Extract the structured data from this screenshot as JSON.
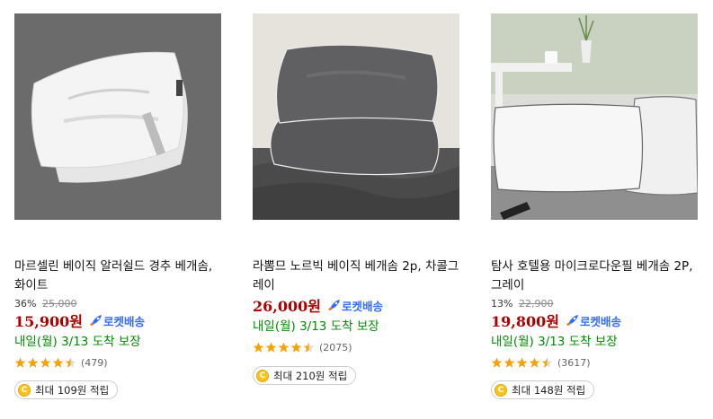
{
  "products": [
    {
      "name": "마르셀린 베이직 알러쉴드 경추 베개솜, 화이트",
      "discount_rate": "36%",
      "original_price": "25,000",
      "price": "15,900원",
      "delivery_badge": "로켓배송",
      "arrival": "내일(월) 3/13 도착 보장",
      "rating": 4.5,
      "review_count": "(479)",
      "reward": "최대 109원 적립",
      "image": "white-neck-pillow-gray-background"
    },
    {
      "name": "라뽐므 노르빅 베이직 베개솜 2p, 차콜그레이",
      "discount_rate": "",
      "original_price": "",
      "price": "26,000원",
      "delivery_badge": "로켓배송",
      "arrival": "내일(월) 3/13 도착 보장",
      "rating": 4.5,
      "review_count": "(2075)",
      "reward": "최대 210원 적립",
      "image": "charcoal-pillows-stack"
    },
    {
      "name": "탐사 호텔용 마이크로다운필 베개솜 2P, 그레이",
      "discount_rate": "13%",
      "original_price": "22,900",
      "price": "19,800원",
      "delivery_badge": "로켓배송",
      "arrival": "내일(월) 3/13 도착 보장",
      "rating": 4.5,
      "review_count": "(3617)",
      "reward": "최대 148원 적립",
      "image": "white-hotel-pillows-bedroom"
    }
  ],
  "coin_symbol": "C",
  "colors": {
    "price": "#ae0000",
    "rocket": "#346aff",
    "arrival": "#008c00",
    "star": "#f5a300",
    "coin": "#f7c31c"
  }
}
